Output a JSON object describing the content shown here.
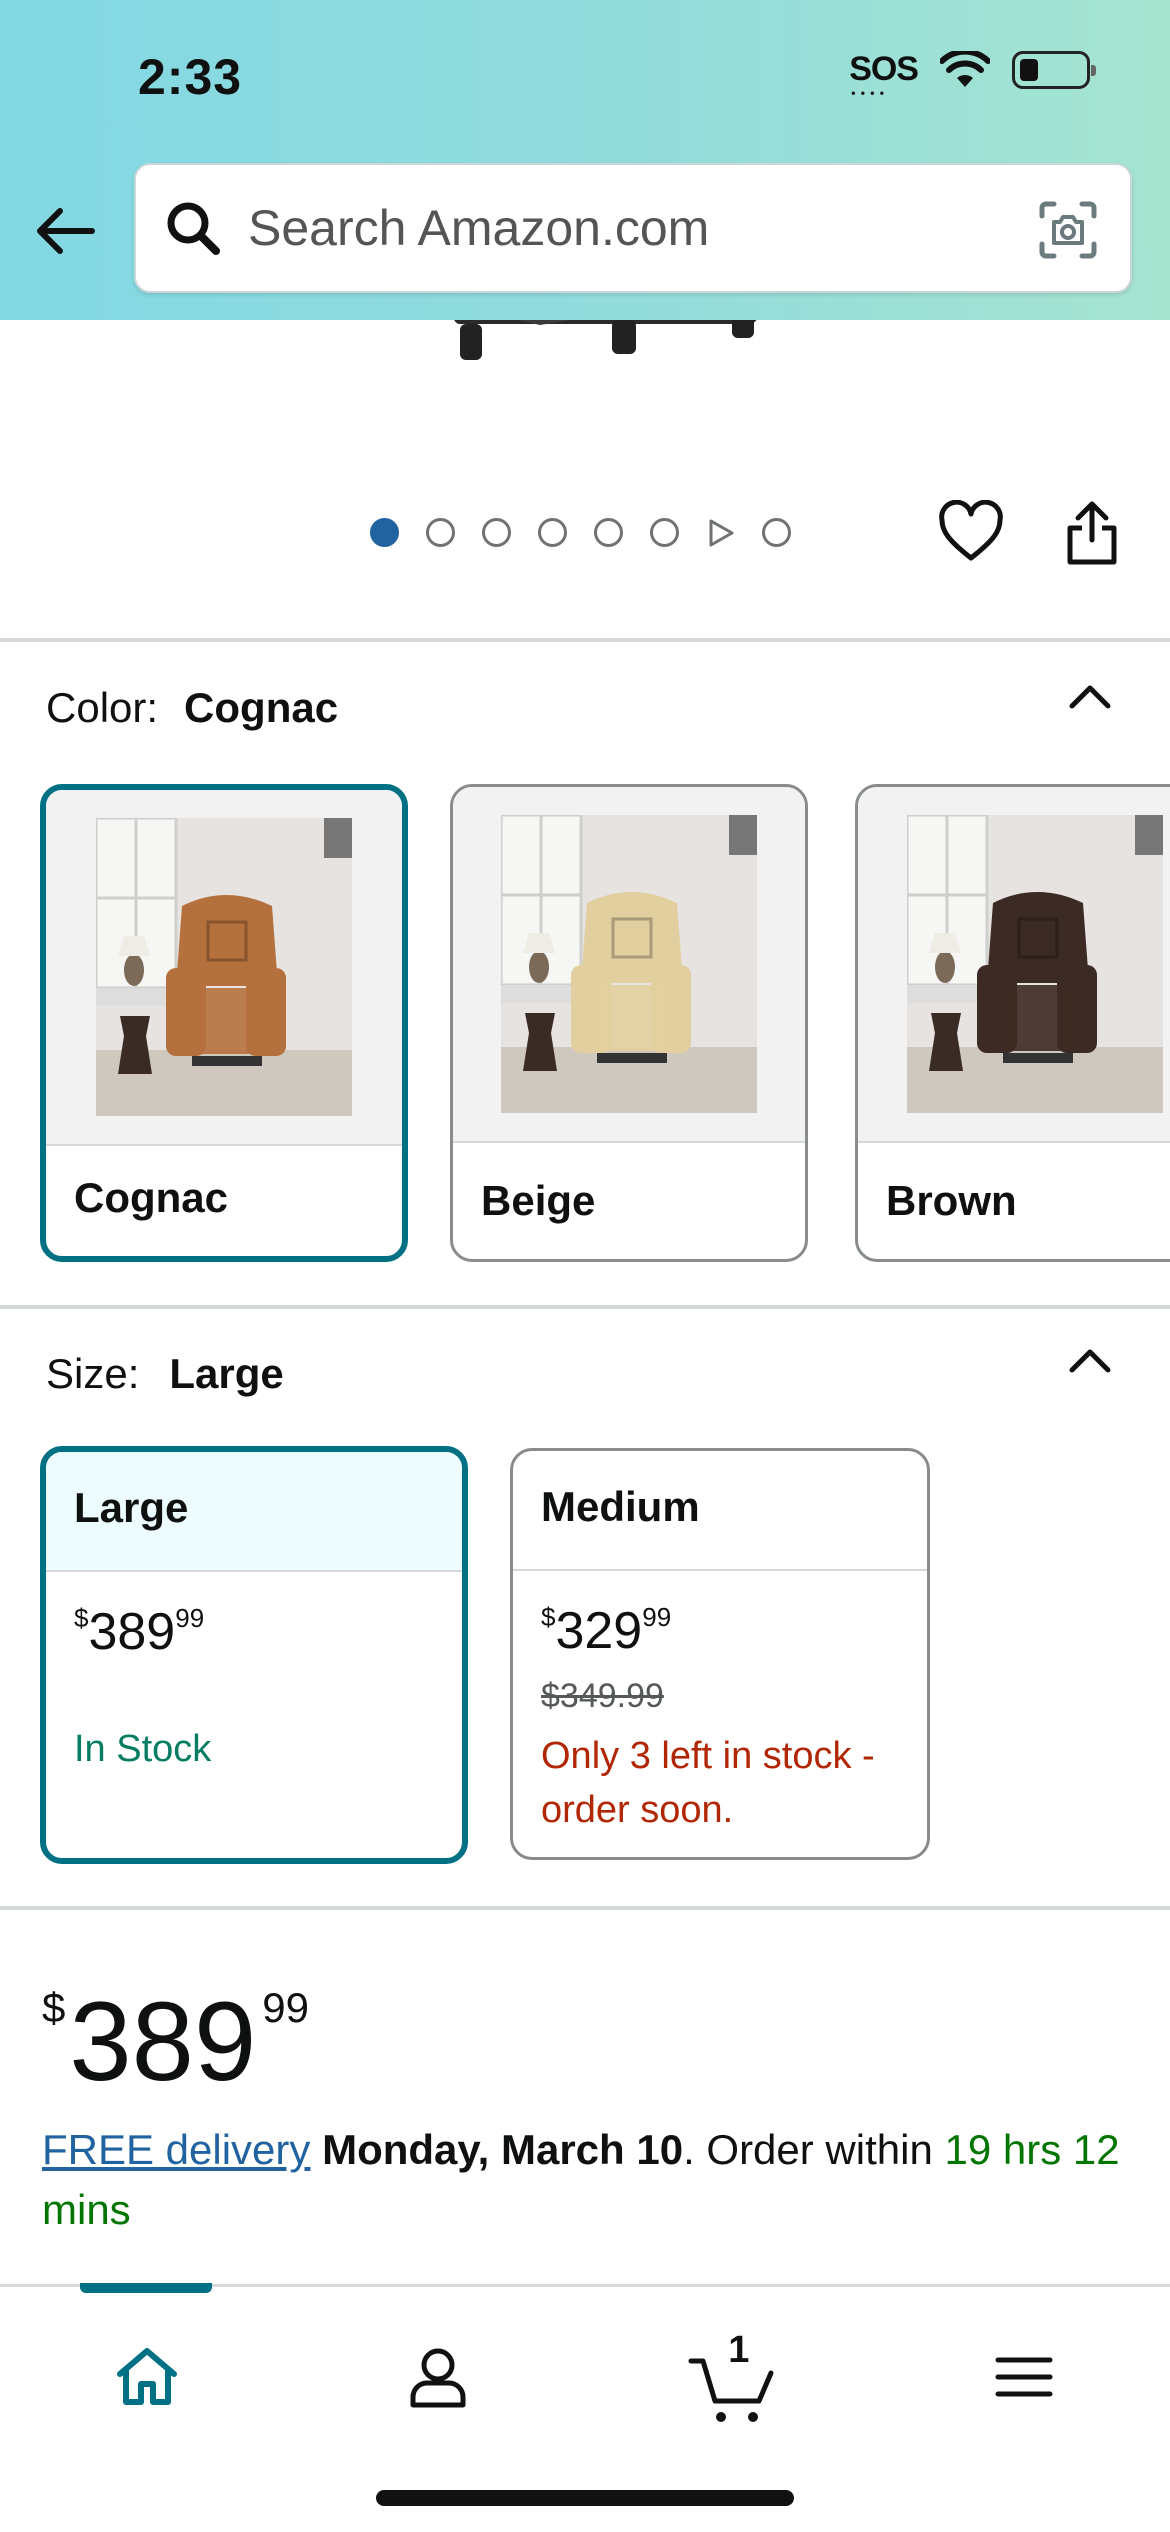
{
  "status_bar": {
    "time": "2:33",
    "sos": "SOS"
  },
  "header": {
    "back_icon": "arrow-left-icon",
    "search_placeholder": "Search Amazon.com",
    "lens_icon": "camera-lens-icon"
  },
  "gallery": {
    "image_count": 8,
    "active_index": 0
  },
  "color_section": {
    "label": "Color:",
    "selected": "Cognac",
    "options": [
      {
        "name": "Cognac",
        "selected": true,
        "chair_color": "#b5713d"
      },
      {
        "name": "Beige",
        "selected": false,
        "chair_color": "#e2cf9f"
      },
      {
        "name": "Brown",
        "selected": false,
        "chair_color": "#3c2a24"
      }
    ]
  },
  "size_section": {
    "label": "Size:",
    "selected": "Large",
    "options": [
      {
        "name": "Large",
        "currency": "$",
        "price_whole": "389",
        "price_cents": "99",
        "list_price": "",
        "stock": "In Stock",
        "selected": true
      },
      {
        "name": "Medium",
        "currency": "$",
        "price_whole": "329",
        "price_cents": "99",
        "list_price": "$349.99",
        "stock": "Only 3 left in stock - order soon.",
        "selected": false
      }
    ]
  },
  "price": {
    "currency": "$",
    "whole": "389",
    "cents": "99"
  },
  "delivery": {
    "link": "FREE delivery",
    "date": "Monday, March 10",
    "order_prefix": ". Order within ",
    "countdown": "19 hrs 12 mins"
  },
  "bottom_nav": {
    "items": [
      "home-icon",
      "account-icon",
      "cart-icon",
      "menu-icon"
    ],
    "active": "home",
    "cart_count": "1"
  },
  "colors": {
    "accent": "#007185",
    "link": "#2162a1",
    "in_stock": "#067d62",
    "low_stock": "#b12704",
    "green": "#007600"
  }
}
